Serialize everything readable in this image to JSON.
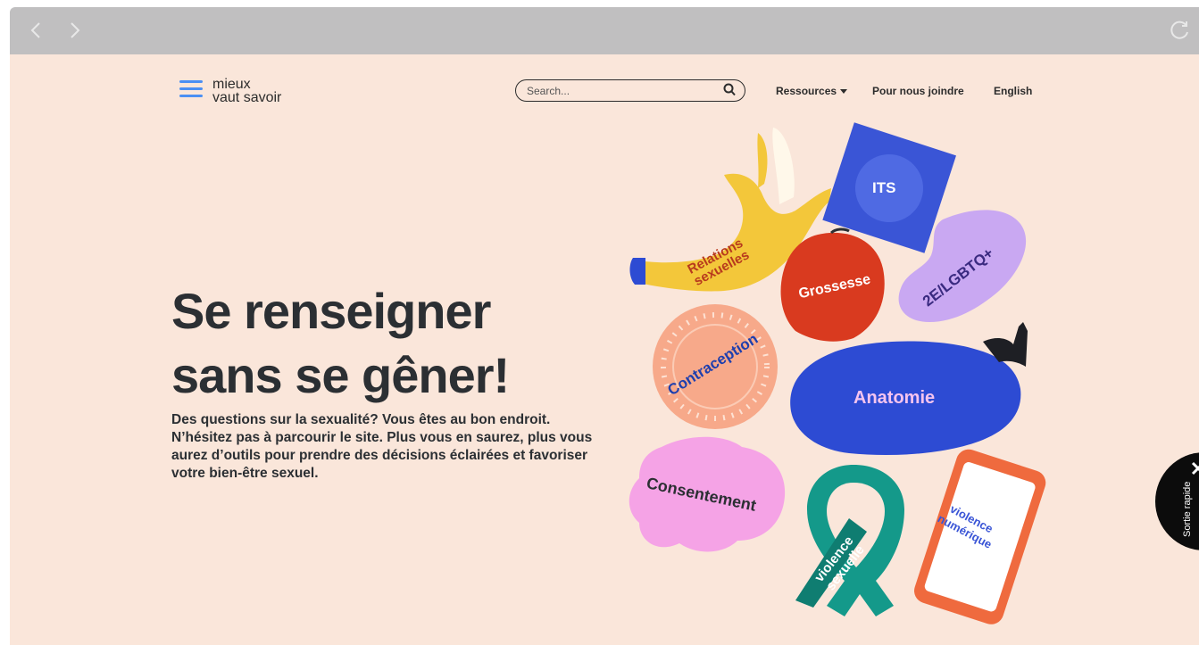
{
  "header": {
    "logo_line1": "mieux",
    "logo_line2": "vaut savoir",
    "search_placeholder": "Search...",
    "nav": {
      "resources": "Ressources",
      "contact": "Pour nous joindre",
      "language": "English"
    }
  },
  "hero": {
    "title_line1": "Se renseigner",
    "title_line2": "sans se gêner!",
    "text": "Des questions sur la sexualité? Vous êtes au bon endroit. N’hésitez pas à parcourir le site. Plus vous en saurez, plus vous aurez d’outils pour prendre des décisions éclairées et favoriser votre bien-être sexuel."
  },
  "topics": {
    "relations_line1": "Relations",
    "relations_line2": "sexuelles",
    "its": "ITS",
    "grossesse": "Grossesse",
    "lgbtq": "2E/LGBTQ+",
    "contraception": "Contraception",
    "anatomie": "Anatomie",
    "consentement": "Consentement",
    "violence_sexuelle_line1": "violence",
    "violence_sexuelle_line2": "sexuelle",
    "violence_numerique_line1": "violence",
    "violence_numerique_line2": "numérique"
  },
  "quick_exit": {
    "label": "Sortie rapide"
  },
  "colors": {
    "page_bg": "#fae6da",
    "accent_blue": "#4b8ff3",
    "text_dark": "#2b2f33",
    "banana": "#f3c73a",
    "its_blue": "#3a55d6",
    "apple_red": "#d93a1f",
    "lgbtq_purple": "#c9a8f2",
    "contraception_peach": "#f7a98a",
    "eggplant_blue": "#2d4bd3",
    "consent_pink": "#f5a3e6",
    "ribbon_teal": "#14998a",
    "phone_orange": "#ef6a3e"
  }
}
